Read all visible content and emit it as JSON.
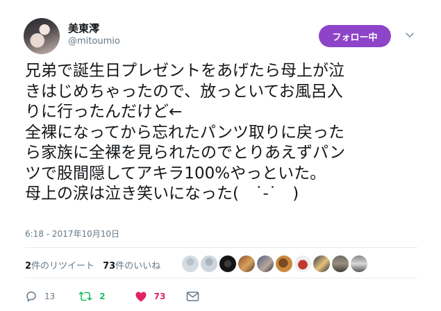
{
  "user": {
    "display_name": "美東澪",
    "screen_name": "@mitoumio",
    "follow_button": "フォロー中"
  },
  "tweet": {
    "lines": [
      "兄弟で誕生日プレゼントをあげたら母上が泣",
      "きはじめちゃったので、放っといてお風呂入",
      "りに行ったんだけど←",
      "全裸になってから忘れたパンツ取りに戻った",
      "ら家族に全裸を見られたのでとりあえずパン",
      "ツで股間隠してアキラ100%やっといた。",
      "母上の涙は泣き笑いになった(　˙-˙　)"
    ],
    "timestamp": "6:18 - 2017年10月10日"
  },
  "stats": {
    "retweet_count": "2",
    "retweet_label": "件のリツイート",
    "like_count": "73",
    "like_label": "件のいいね"
  },
  "actions": {
    "reply_count": "13",
    "retweet_count": "2",
    "like_count": "73"
  },
  "colors": {
    "follow_bg": "#8e44c9",
    "retweet": "#17bf63",
    "like": "#e0245e",
    "secondary_text": "#657786"
  }
}
